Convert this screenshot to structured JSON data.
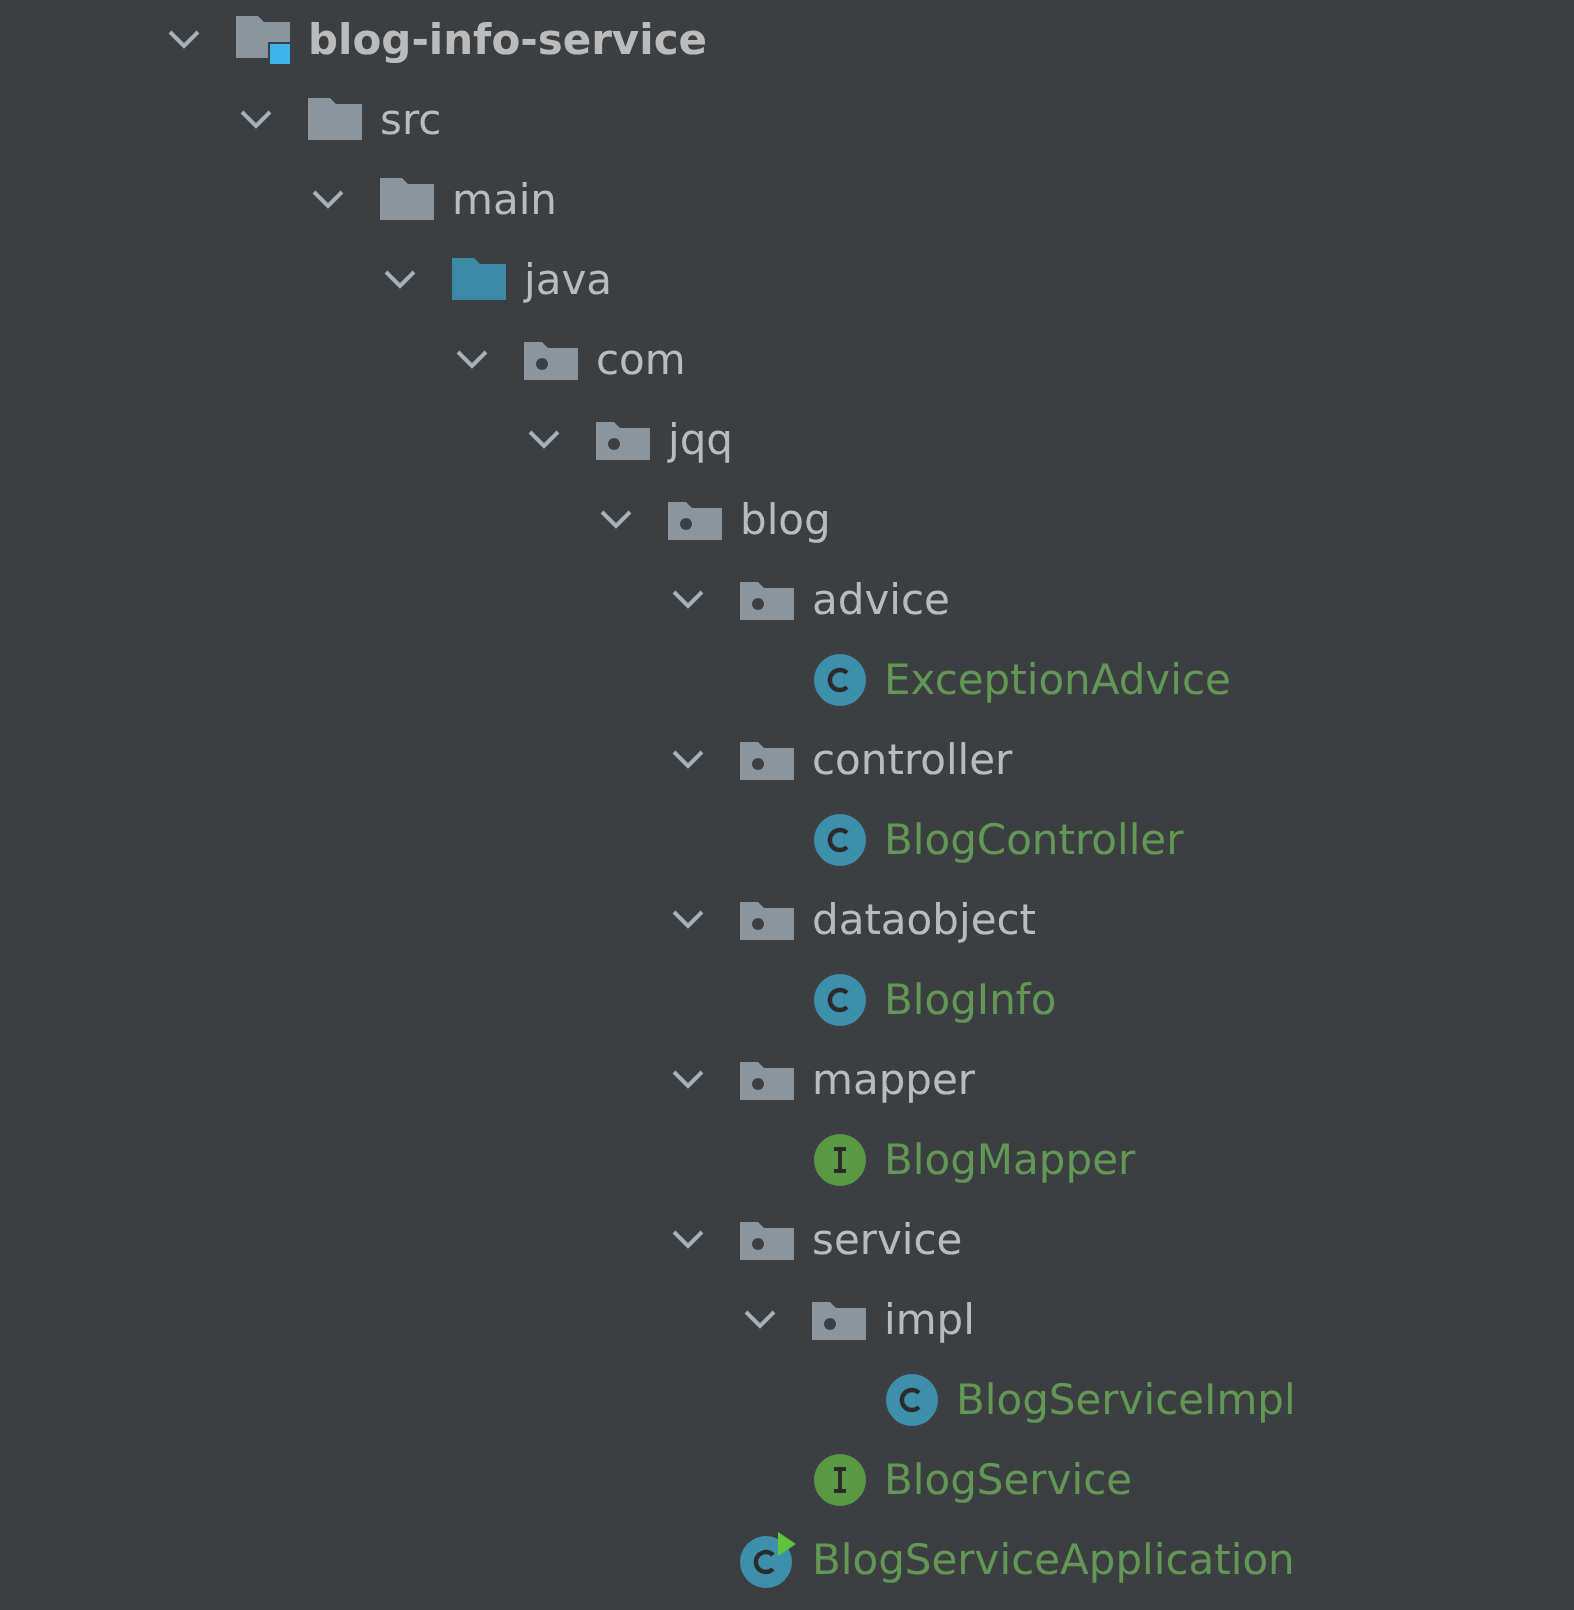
{
  "project_tree": [
    {
      "name": "blog-info-service",
      "kind": "module",
      "expanded": true,
      "children": [
        {
          "name": "src",
          "kind": "folder",
          "expanded": true,
          "children": [
            {
              "name": "main",
              "kind": "folder",
              "expanded": true,
              "children": [
                {
                  "name": "java",
                  "kind": "source-folder",
                  "expanded": true,
                  "children": [
                    {
                      "name": "com",
                      "kind": "package",
                      "expanded": true,
                      "children": [
                        {
                          "name": "jqq",
                          "kind": "package",
                          "expanded": true,
                          "children": [
                            {
                              "name": "blog",
                              "kind": "package",
                              "expanded": true,
                              "children": [
                                {
                                  "name": "advice",
                                  "kind": "package",
                                  "expanded": true,
                                  "children": [
                                    {
                                      "name": "ExceptionAdvice",
                                      "kind": "class"
                                    }
                                  ]
                                },
                                {
                                  "name": "controller",
                                  "kind": "package",
                                  "expanded": true,
                                  "children": [
                                    {
                                      "name": "BlogController",
                                      "kind": "class"
                                    }
                                  ]
                                },
                                {
                                  "name": "dataobject",
                                  "kind": "package",
                                  "expanded": true,
                                  "children": [
                                    {
                                      "name": "BlogInfo",
                                      "kind": "class"
                                    }
                                  ]
                                },
                                {
                                  "name": "mapper",
                                  "kind": "package",
                                  "expanded": true,
                                  "children": [
                                    {
                                      "name": "BlogMapper",
                                      "kind": "interface"
                                    }
                                  ]
                                },
                                {
                                  "name": "service",
                                  "kind": "package",
                                  "expanded": true,
                                  "children": [
                                    {
                                      "name": "impl",
                                      "kind": "package",
                                      "expanded": true,
                                      "children": [
                                        {
                                          "name": "BlogServiceImpl",
                                          "kind": "class"
                                        }
                                      ]
                                    },
                                    {
                                      "name": "BlogService",
                                      "kind": "interface"
                                    }
                                  ]
                                },
                                {
                                  "name": "BlogServiceApplication",
                                  "kind": "app-class"
                                }
                              ]
                            }
                          ]
                        }
                      ]
                    }
                  ]
                }
              ]
            }
          ]
        }
      ]
    }
  ]
}
